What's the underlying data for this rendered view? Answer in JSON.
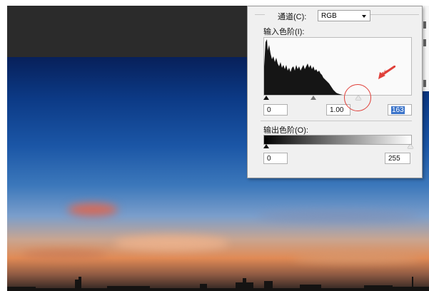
{
  "levels_dialog": {
    "channel_label": "通道(C):",
    "channel_value": "RGB",
    "input_levels_label": "输入色阶(I):",
    "input_black": "0",
    "input_gamma": "1.00",
    "input_white": "163",
    "output_levels_label": "输出色阶(O):",
    "output_black": "0",
    "output_white": "255"
  },
  "colors": {
    "annotation": "#e0403a",
    "selection": "#3a73c9"
  }
}
